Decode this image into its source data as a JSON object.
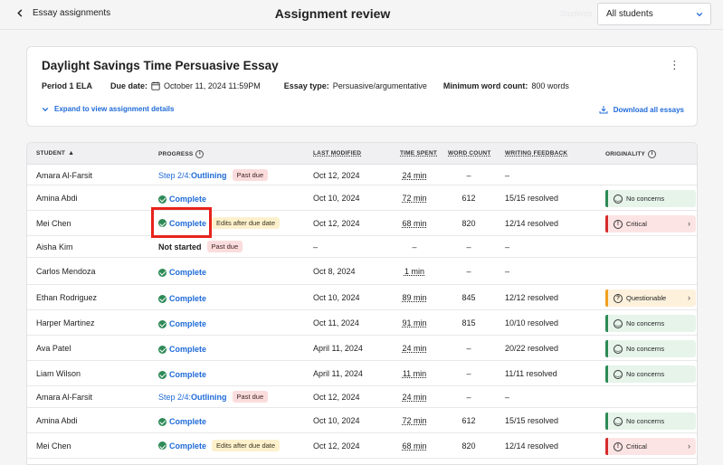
{
  "header": {
    "back_label": "Essay assignments",
    "title": "Assignment review",
    "ghost_label": "Students",
    "filter_value": "All students"
  },
  "assignment": {
    "title": "Daylight Savings Time Persuasive Essay",
    "class_name": "Period 1 ELA",
    "due_label": "Due date:",
    "due_value": "October 11, 2024 11:59PM",
    "type_label": "Essay type:",
    "type_value": "Persuasive/argumentative",
    "min_label": "Minimum word count:",
    "min_value": "800 words",
    "expand_label": "Expand to view assignment details",
    "download_label": "Download all essays"
  },
  "columns": {
    "student": "STUDENT",
    "progress": "PROGRESS",
    "last_modified": "LAST MODIFIED",
    "time_spent": "TIME SPENT",
    "word_count": "WORD COUNT",
    "feedback": "WRITING FEEDBACK",
    "originality": "ORIGINALITY"
  },
  "rows": [
    {
      "name": "Amara Al-Farsit",
      "progress": "step",
      "step_prefix": "Step 2/4:",
      "step_name": "Outlining",
      "tag": "Past due",
      "modified": "Oct 12, 2024",
      "time": "24 min",
      "words": "–",
      "feedback": "–"
    },
    {
      "name": "Amina Abdi",
      "progress": "Complete",
      "modified": "Oct 10, 2024",
      "time": "72 min",
      "words": "612",
      "feedback": "15/15 resolved",
      "orig": "No concerns"
    },
    {
      "name": "Mei Chen",
      "progress": "Complete",
      "tag": "Edits after due date",
      "modified": "Oct 12, 2024",
      "time": "68 min",
      "words": "820",
      "feedback": "12/14 resolved",
      "orig": "Critical"
    },
    {
      "name": "Aisha Kim",
      "progress": "Not started",
      "tag": "Past due",
      "modified": "–",
      "time": "–",
      "words": "–",
      "feedback": "–"
    },
    {
      "name": "Carlos Mendoza",
      "progress": "Complete",
      "modified": "Oct 8, 2024",
      "time": "1 min",
      "words": "–",
      "feedback": "–"
    },
    {
      "name": "Ethan Rodriguez",
      "progress": "Complete",
      "modified": "Oct 10, 2024",
      "time": "89 min",
      "words": "845",
      "feedback": "12/12 resolved",
      "orig": "Questionable"
    },
    {
      "name": "Harper Martinez",
      "progress": "Complete",
      "modified": "Oct 11, 2024",
      "time": "91 min",
      "words": "815",
      "feedback": "10/10 resolved",
      "orig": "No concerns"
    },
    {
      "name": "Ava Patel",
      "progress": "Complete",
      "modified": "April 11, 2024",
      "time": "24 min",
      "words": "–",
      "feedback": "20/22 resolved",
      "orig": "No concerns"
    },
    {
      "name": "Liam Wilson",
      "progress": "Complete",
      "modified": "April 11, 2024",
      "time": "11 min",
      "words": "–",
      "feedback": "11/11 resolved",
      "orig": "No concerns"
    },
    {
      "name": "Amara Al-Farsit",
      "progress": "step",
      "step_prefix": "Step 2/4:",
      "step_name": "Outlining",
      "tag": "Past due",
      "modified": "Oct 12, 2024",
      "time": "24 min",
      "words": "–",
      "feedback": "–"
    },
    {
      "name": "Amina Abdi",
      "progress": "Complete",
      "modified": "Oct 10, 2024",
      "time": "72 min",
      "words": "612",
      "feedback": "15/15 resolved",
      "orig": "No concerns"
    },
    {
      "name": "Mei Chen",
      "progress": "Complete",
      "tag": "Edits after due date",
      "modified": "Oct 12, 2024",
      "time": "68 min",
      "words": "820",
      "feedback": "12/14 resolved",
      "orig": "Critical"
    }
  ],
  "colors": {
    "accent": "#1f6bd8",
    "complete": "#2e8a57",
    "critical": "#d62c2c",
    "questionable": "#f0a020",
    "highlight": "#e8231c"
  }
}
